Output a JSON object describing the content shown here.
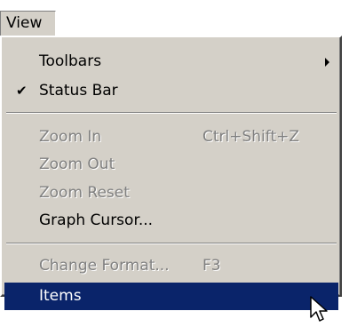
{
  "menubar": {
    "view_label": "View"
  },
  "menu": {
    "items": [
      {
        "label": "Toolbars",
        "has_submenu": true
      },
      {
        "label": "Status Bar",
        "checked": true,
        "check_glyph": "✔"
      },
      {
        "label": "Zoom In",
        "shortcut": "Ctrl+Shift+Z",
        "disabled": true
      },
      {
        "label": "Zoom Out",
        "disabled": true
      },
      {
        "label": "Zoom Reset",
        "disabled": true
      },
      {
        "label": "Graph Cursor..."
      },
      {
        "label": "Change Format...",
        "shortcut": "F3",
        "disabled": true
      },
      {
        "label": "Items",
        "selected": true
      }
    ]
  },
  "colors": {
    "menu_bg": "#d4d0c8",
    "highlight": "#0a246a",
    "disabled_text": "#808080"
  },
  "icons": {
    "cursor": "mouse-pointer-icon",
    "submenu": "submenu-arrow-icon",
    "check": "checkmark-icon"
  }
}
